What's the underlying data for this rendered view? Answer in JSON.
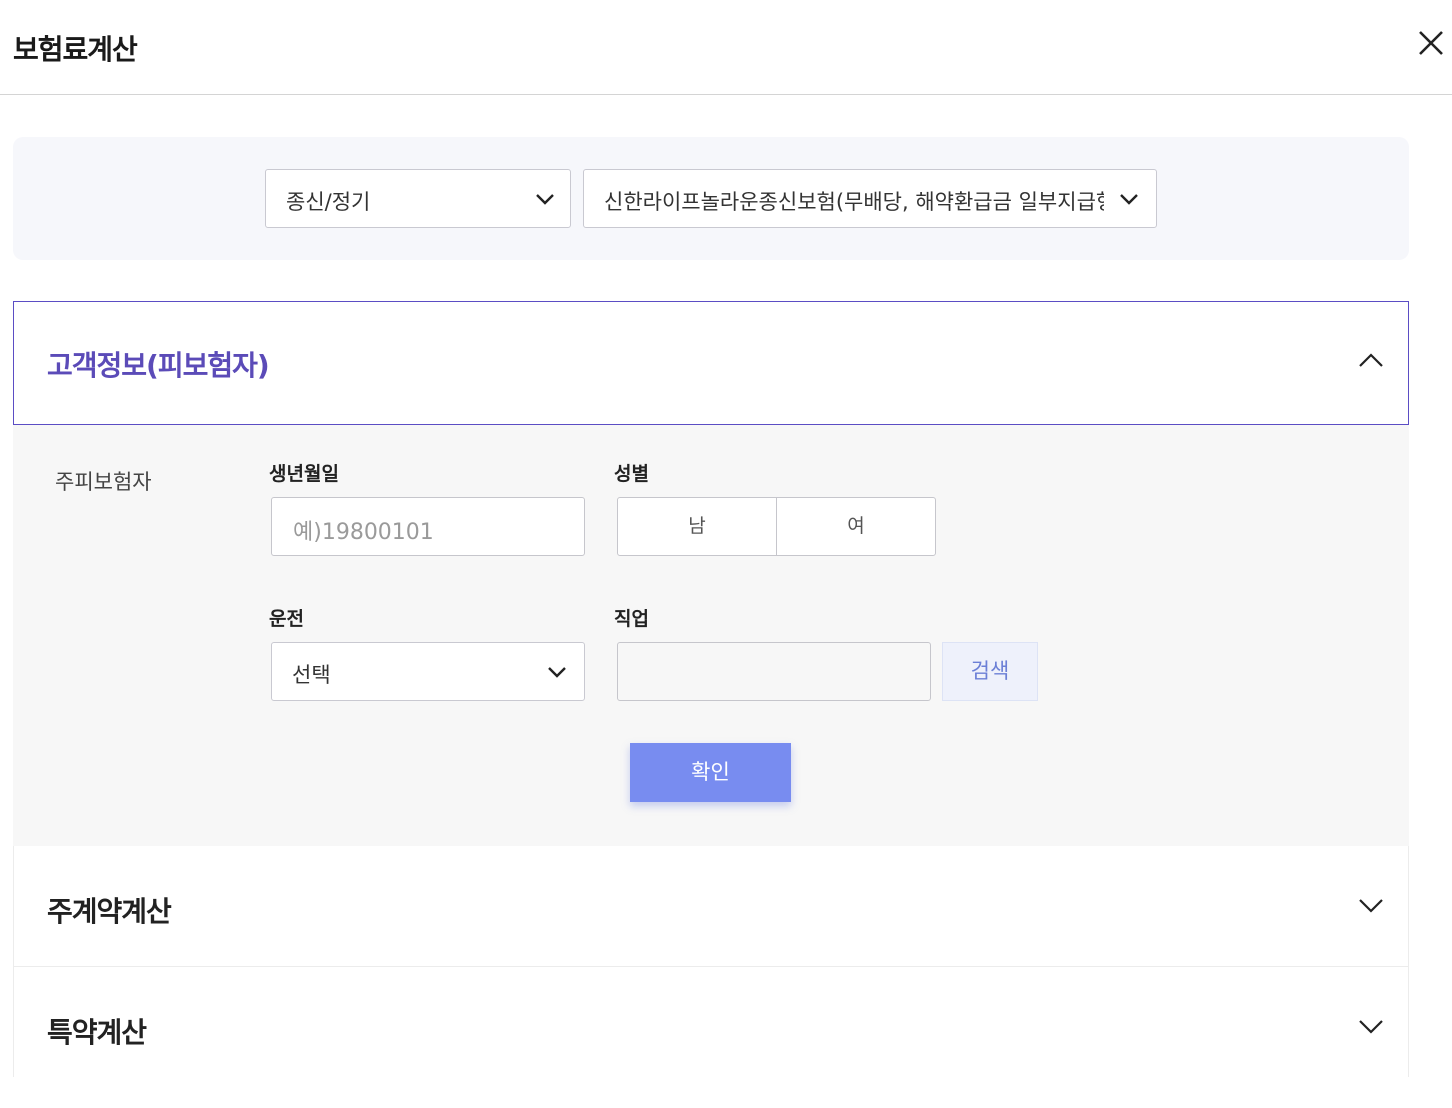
{
  "header": {
    "title": "보험료계산"
  },
  "product": {
    "category_value": "종신/정기",
    "product_value": "신한라이프놀라운종신보험(무배당, 해약환급금 일부지급형)"
  },
  "sections": {
    "customer": {
      "title": "고객정보(피보험자)",
      "insured_label": "주피보험자",
      "birth_label": "생년월일",
      "birth_placeholder": "예)19800101",
      "gender_label": "성별",
      "gender_male": "남",
      "gender_female": "여",
      "driving_label": "운전",
      "driving_value": "선택",
      "job_label": "직업",
      "job_value": "",
      "search_label": "검색",
      "confirm_label": "확인"
    },
    "main_contract": {
      "title": "주계약계산"
    },
    "rider": {
      "title": "특약계산"
    }
  },
  "colors": {
    "accent": "#5b4bb8",
    "confirm_button": "#788cf0",
    "search_text": "#6b7fd6"
  }
}
